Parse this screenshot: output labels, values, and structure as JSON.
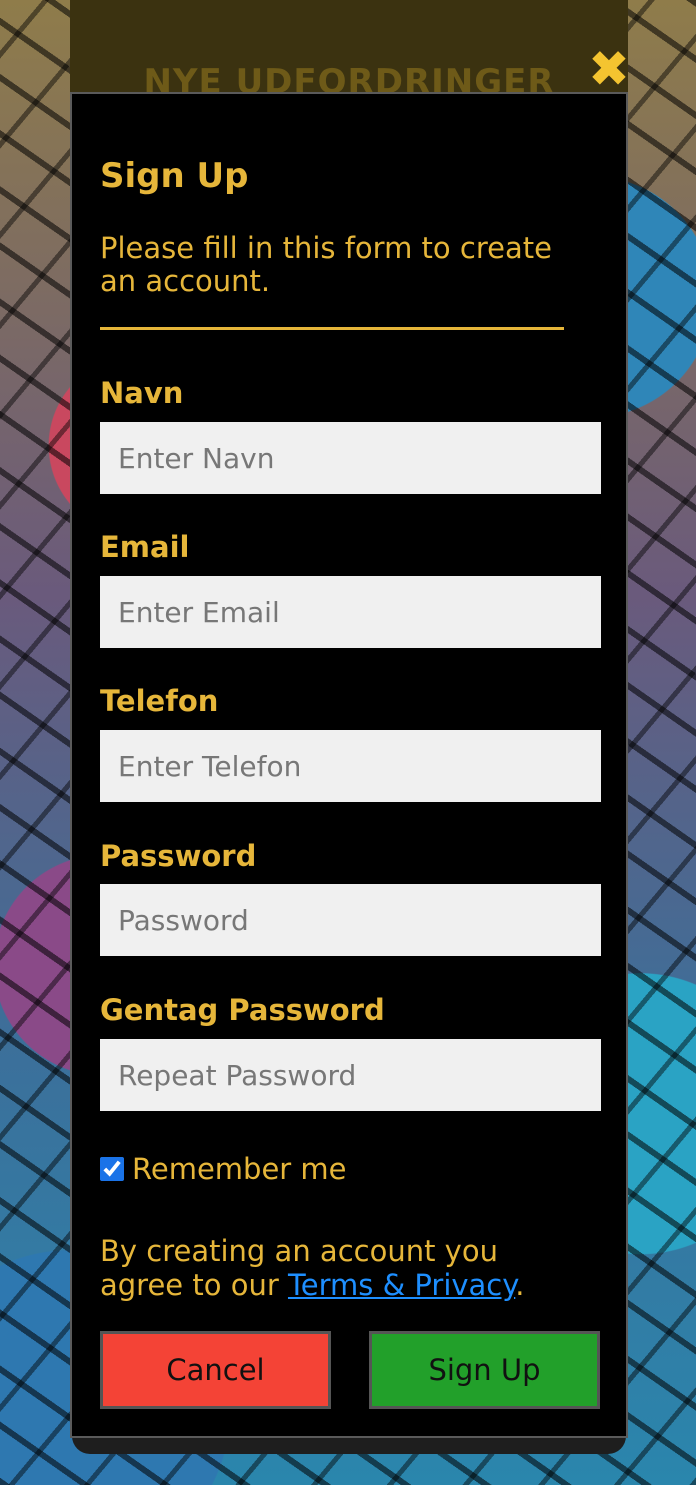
{
  "backdrop": {
    "title": "NYE UDFORDRINGER"
  },
  "modal": {
    "close_glyph": "✖",
    "title": "Sign Up",
    "subtitle": "Please fill in this form to create an account.",
    "fields": [
      {
        "label": "Navn",
        "placeholder": "Enter Navn",
        "value": ""
      },
      {
        "label": "Email",
        "placeholder": "Enter Email",
        "value": ""
      },
      {
        "label": "Telefon",
        "placeholder": "Enter Telefon",
        "value": ""
      },
      {
        "label": "Password",
        "placeholder": "Password",
        "value": ""
      },
      {
        "label": "Gentag Password",
        "placeholder": "Repeat Password",
        "value": ""
      }
    ],
    "remember": {
      "label": "Remember me",
      "checked": true
    },
    "terms": {
      "prefix": "By creating an account you agree to our ",
      "link": "Terms & Privacy",
      "suffix": "."
    },
    "buttons": {
      "cancel": "Cancel",
      "signup": "Sign Up"
    }
  },
  "colors": {
    "accent": "#e6b63a",
    "cancel": "#f44336",
    "signup": "#22a02a",
    "link": "#1e8fff"
  }
}
